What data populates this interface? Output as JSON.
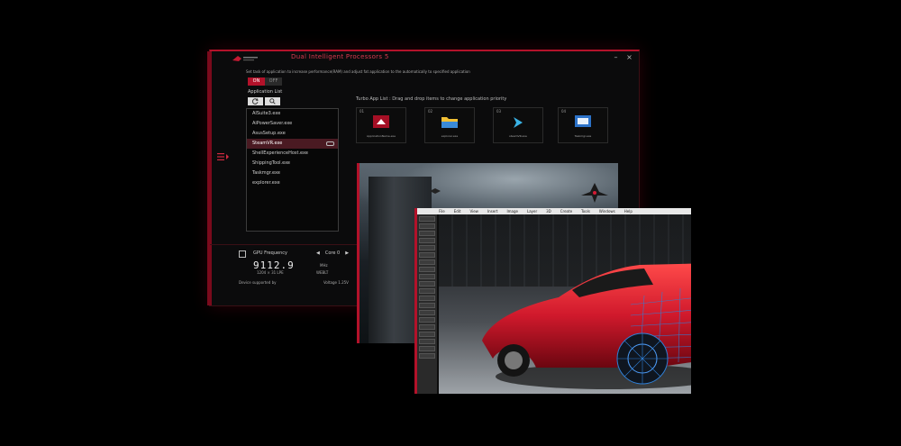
{
  "app": {
    "title": "Dual Intelligent Processors 5",
    "description": "Set task of application to increase performance(RAM) and adjust fat application to the automatically to specified application",
    "toggle": {
      "on": "ON",
      "off": "OFF"
    },
    "app_list_label": "Application List",
    "drag_hint": "Turbo App List : Drag and drop items to change application priority",
    "app_list": [
      "AISuite3.exe",
      "AiPowerSaver.exe",
      "AsusSetup.exe",
      "SteamVR.exe",
      "ShellExperienceHost.exe",
      "ShippingTool.exe",
      "Taskmgr.exe",
      "explorer.exe"
    ],
    "selected_index": 3,
    "slots": [
      {
        "num": "01",
        "name": "ApplicationName.exe"
      },
      {
        "num": "02",
        "name": "explorer.exe"
      },
      {
        "num": "03",
        "name": "steamVR.exe"
      },
      {
        "num": "04",
        "name": "Taskmgr.exe"
      }
    ],
    "gpu": {
      "label": "GPU Frequency",
      "core": "Core 0",
      "value": "9112.9",
      "unit": "MHz",
      "sub1": "1204 × 31 LPE",
      "sub2": "WEBLT",
      "footer_left": "Device supported by",
      "footer_right": "Voltage 1.25V"
    }
  },
  "editor": {
    "menu": [
      "File",
      "Edit",
      "View",
      "Insert",
      "Image",
      "Layer",
      "3D",
      "Create",
      "Tools",
      "Windows",
      "Help"
    ]
  },
  "colors": {
    "accent": "#b3122a",
    "car": "#d0192c",
    "wireframe": "#2f7fd6"
  }
}
